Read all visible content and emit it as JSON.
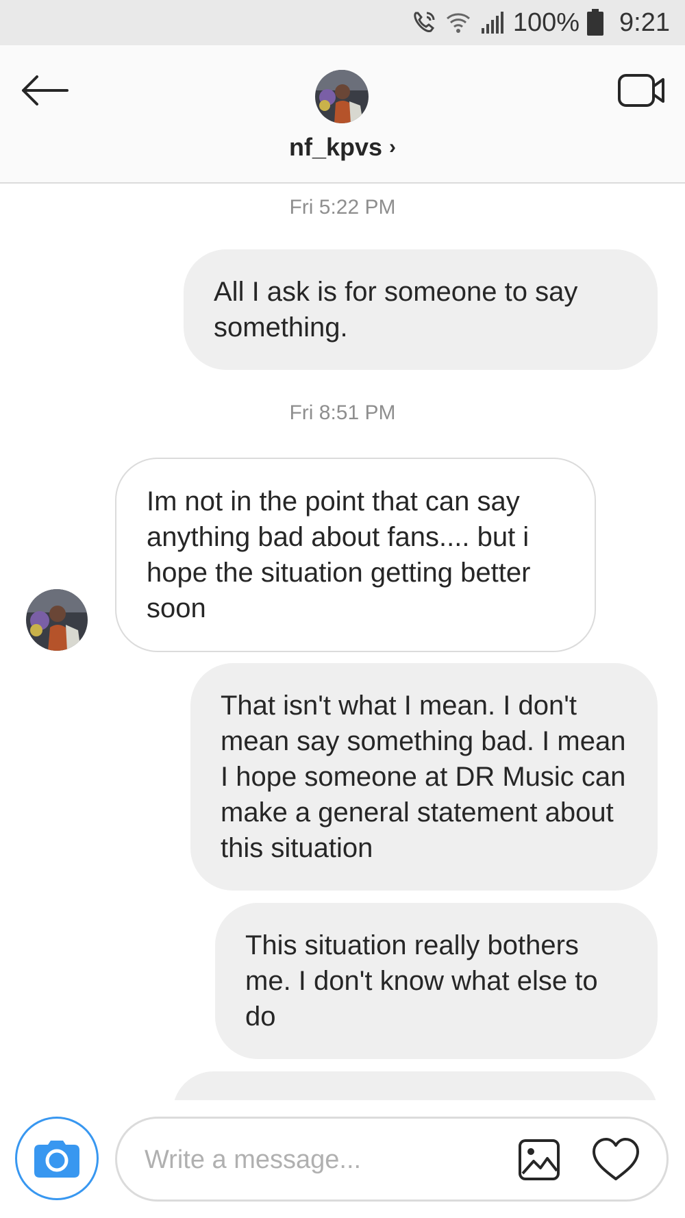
{
  "status_bar": {
    "battery": "100%",
    "time": "9:21",
    "icons": [
      "wifi-call-icon",
      "wifi-icon",
      "signal-icon",
      "battery-icon"
    ]
  },
  "header": {
    "username": "nf_kpvs",
    "chevron": "›",
    "icons": [
      "back-arrow-icon",
      "video-call-icon"
    ]
  },
  "thread": {
    "timestamp_1": "Fri 5:22 PM",
    "timestamp_2": "Fri 8:51 PM",
    "messages": [
      {
        "direction": "out",
        "text": "All I ask is for someone to say something."
      },
      {
        "direction": "in",
        "text": "Im not in the point that can say anything bad about fans.... but i hope the situation getting better soon"
      },
      {
        "direction": "out",
        "text": "That isn't what I mean. I don't mean say something bad. I mean I hope someone at DR Music can make a general statement about this situation"
      },
      {
        "direction": "out",
        "text": "This situation really bothers me. I don't know what else to do"
      },
      {
        "direction": "out",
        "text": ""
      }
    ]
  },
  "composer": {
    "placeholder": "Write a message...",
    "icons": [
      "camera-icon",
      "gallery-icon",
      "heart-icon"
    ],
    "accent_color": "#3897f0"
  }
}
